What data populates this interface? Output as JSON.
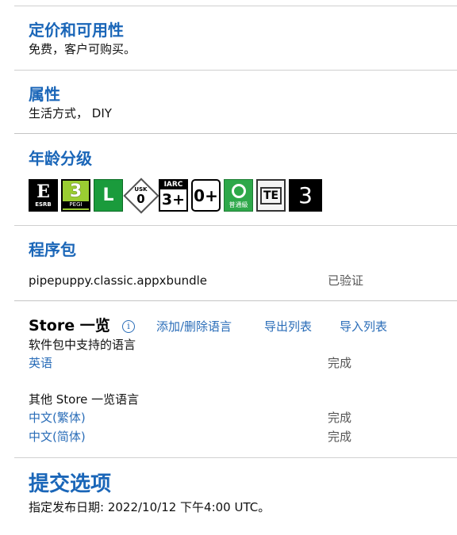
{
  "pricing": {
    "title": "定价和可用性",
    "text": "免费，客户可购买。"
  },
  "properties": {
    "title": "属性",
    "text": "生活方式， DIY"
  },
  "age": {
    "title": "年龄分级",
    "badges": [
      "ESRB",
      "3",
      "PEGI",
      "L",
      "USK",
      "0",
      "IARC",
      "3+",
      "0+",
      "普通級",
      "TE",
      "3"
    ]
  },
  "packages": {
    "title": "程序包",
    "file": "pipepuppy.classic.appxbundle",
    "status": "已验证"
  },
  "store": {
    "title": "Store 一览",
    "info_icon": "i",
    "add_remove": "添加/删除语言",
    "export": "导出列表",
    "import": "导入列表",
    "supported_label": "软件包中支持的语言",
    "supported": [
      {
        "lang": "英语",
        "status": "完成"
      }
    ],
    "other_label": "其他 Store 一览语言",
    "other": [
      {
        "lang": "中文(繁体)",
        "status": "完成"
      },
      {
        "lang": "中文(简体)",
        "status": "完成"
      }
    ]
  },
  "submission": {
    "title": "提交选项",
    "text": "指定发布日期: 2022/10/12 下午4:00 UTC。"
  }
}
